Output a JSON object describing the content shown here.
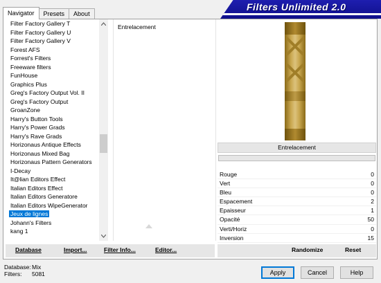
{
  "tabs": [
    "Navigator",
    "Presets",
    "About"
  ],
  "banner": {
    "title": "Filters Unlimited 2.0"
  },
  "filter_list": {
    "items": [
      "Filter Factory Gallery T",
      "Filter Factory Gallery U",
      "Filter Factory Gallery V",
      "Forest AFS",
      "Forrest's Filters",
      "Freeware filters",
      "FunHouse",
      "Graphics Plus",
      "Greg's Factory Output Vol. II",
      "Greg's Factory Output",
      "GroanZone",
      "Harry's Button Tools",
      "Harry's Power Grads",
      "Harry's Rave Grads",
      "Horizonaus Antique Effects",
      "Horizonaus Mixed Bag",
      "Horizonaus Pattern Generators",
      "I-Decay",
      "It@lian Editors Effect",
      "Italian Editors Effect",
      "Italian Editors Generatore",
      "Italian Editors WipeGenerator",
      "Jeux de lignes",
      "Johann's Filters",
      "kang 1"
    ],
    "selected": "Jeux de lignes"
  },
  "filter_panel": {
    "filter_name": "Entrelacement"
  },
  "effect": {
    "name": "Entrelacement"
  },
  "params": [
    {
      "name": "Rouge",
      "value": "0"
    },
    {
      "name": "Vert",
      "value": "0"
    },
    {
      "name": "Bleu",
      "value": "0"
    },
    {
      "name": "Espacement",
      "value": "2"
    },
    {
      "name": "Epaisseur",
      "value": "1"
    },
    {
      "name": "Opacité",
      "value": "50"
    },
    {
      "name": "Verti/Horiz",
      "value": "0"
    },
    {
      "name": "Inversion",
      "value": "15"
    }
  ],
  "left_buttons": {
    "database": "Database",
    "import": "Import...",
    "filter_info": "Filter Info...",
    "editor": "Editor..."
  },
  "right_buttons": {
    "randomize": "Randomize",
    "reset": "Reset"
  },
  "footer": {
    "database_label": "Database:",
    "database_value": "Mix",
    "filters_label": "Filters:",
    "filters_value": "5081"
  },
  "dialog_buttons": {
    "apply": "Apply",
    "cancel": "Cancel",
    "help": "Help"
  },
  "colors": {
    "banner": "#1e1eaf",
    "selection": "#0078d7",
    "preview_gold": "#c9a74f"
  }
}
